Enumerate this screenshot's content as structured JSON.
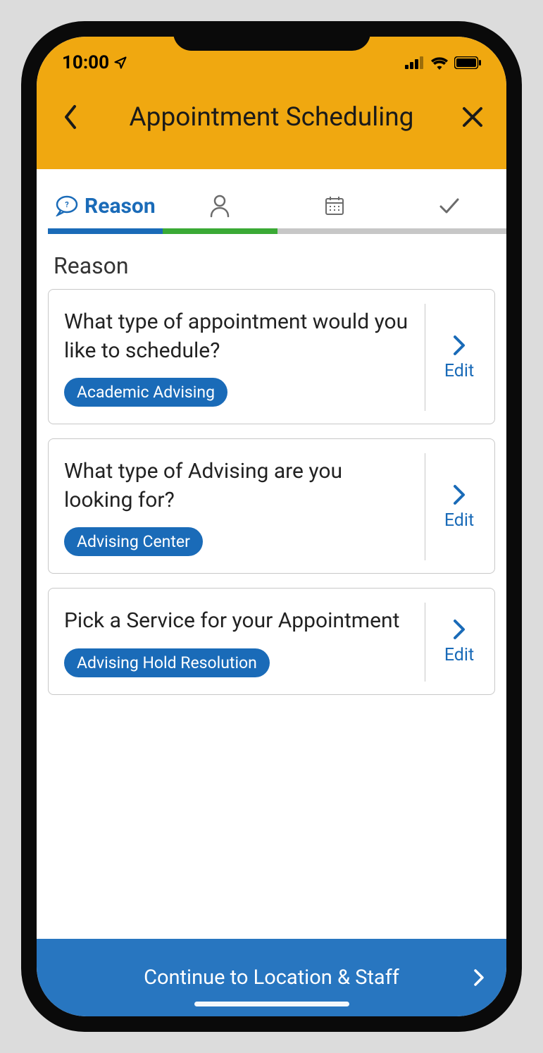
{
  "status_bar": {
    "time": "10:00"
  },
  "header": {
    "title": "Appointment Scheduling"
  },
  "steps": {
    "reason_label": "Reason",
    "colors": {
      "active": "#1a6bb8",
      "done": "#3aaa35",
      "inactive": "#c7c7c7"
    }
  },
  "section_title": "Reason",
  "cards": [
    {
      "question": "What type of appointment would you like to schedule?",
      "tag": "Academic Advising",
      "edit_label": "Edit"
    },
    {
      "question": "What type of Advising are you looking for?",
      "tag": "Advising Center",
      "edit_label": "Edit"
    },
    {
      "question": "Pick a Service for your Appointment",
      "tag": "Advising Hold Resolution",
      "edit_label": "Edit"
    }
  ],
  "bottom_bar": {
    "label": "Continue to Location & Staff"
  }
}
